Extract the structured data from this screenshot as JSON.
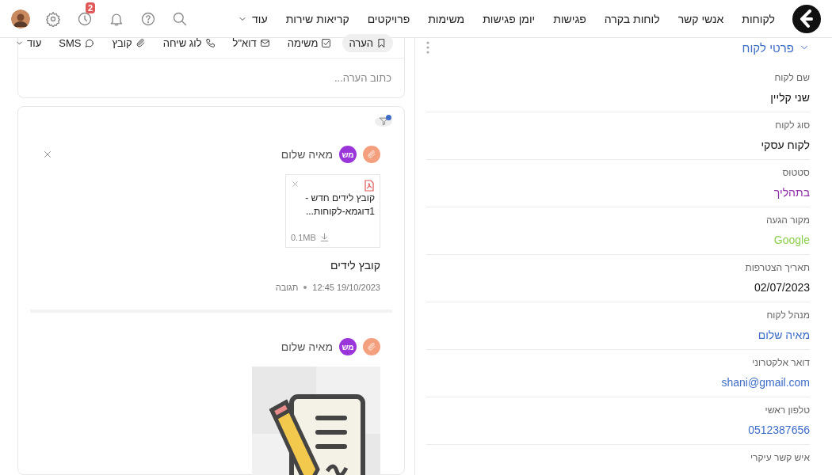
{
  "nav": {
    "links": [
      "לקוחות",
      "אנשי קשר",
      "לוחות בקרה",
      "פגישות",
      "יומן פגישות",
      "משימות",
      "פרויקטים",
      "קריאות שירות"
    ],
    "more": "עוד",
    "reminder_badge": "2"
  },
  "composer": {
    "tabs": [
      {
        "label": "הערה",
        "selected": true
      },
      {
        "label": "משימה",
        "selected": false
      },
      {
        "label": "דוא\"ל",
        "selected": false
      },
      {
        "label": "לוג שיחה",
        "selected": false
      },
      {
        "label": "קובץ",
        "selected": false
      },
      {
        "label": "SMS",
        "selected": false
      }
    ],
    "more": "עוד",
    "placeholder": "כתוב הערה..."
  },
  "activity": {
    "filter_active": true,
    "items": [
      {
        "kind": "file",
        "author": "מאיה שלום",
        "initials": "מש",
        "file_name": "קובץ לידים חדש - 1דוגמא-לקוחות...",
        "file_size": "0.1MB",
        "title": "קובץ לידים",
        "time": "19/10/2023 12:45",
        "action": "תגובה"
      },
      {
        "author": "מאיה שלום",
        "initials": "מש"
      }
    ]
  },
  "details": {
    "title": "פרטי לקוח",
    "fields": [
      {
        "label": "שם לקוח",
        "value": "שני קליין",
        "color": "#111111"
      },
      {
        "label": "סוג לקוח",
        "value": "לקוח עסקי",
        "color": "#111111"
      },
      {
        "label": "סטטוס",
        "value": "בתהליך",
        "color": "#8e2fa6"
      },
      {
        "label": "מקור הגעה",
        "value": "Google",
        "color": "#8ccf4d"
      },
      {
        "label": "תאריך הצטרפות",
        "value": "02/07/2023",
        "color": "#111111"
      },
      {
        "label": "מנהל לקוח",
        "value": "מאיה שלום",
        "color": "#3d6cc7"
      },
      {
        "label": "דואר אלקטרוני",
        "value": "shani@gmail.com",
        "color": "#3d6cc7"
      },
      {
        "label": "טלפון ראשי",
        "value": "0512387656",
        "color": "#3d6cc7"
      },
      {
        "label": "איש קשר עיקרי"
      }
    ]
  }
}
